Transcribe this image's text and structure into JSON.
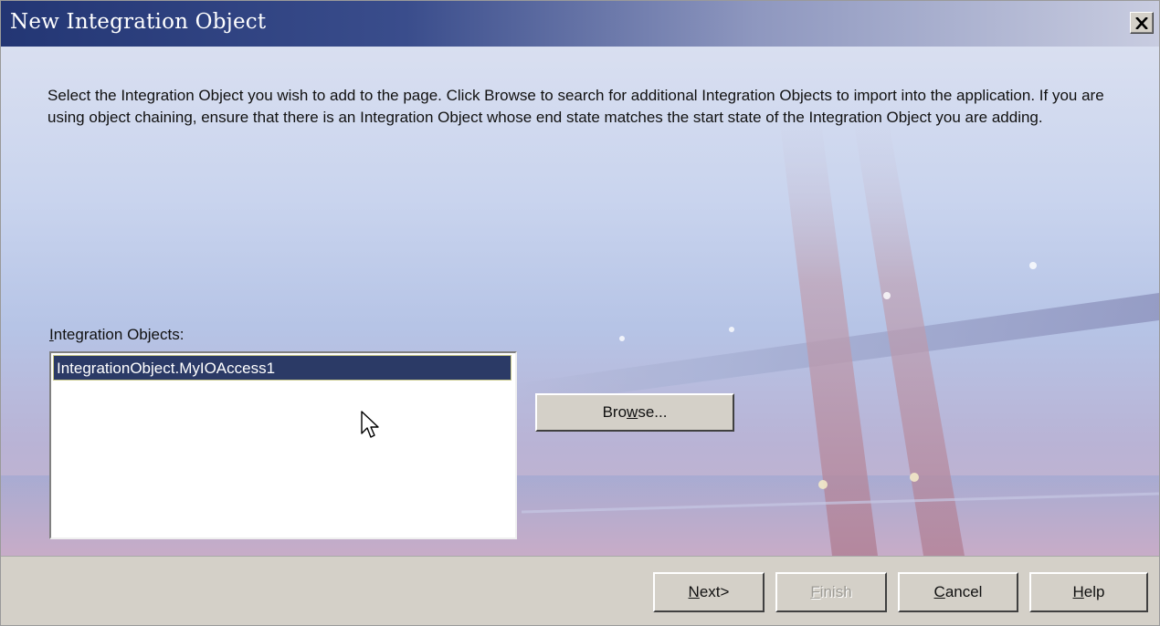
{
  "window": {
    "title": "New Integration Object"
  },
  "instructions": "Select the Integration Object you wish to add to the page. Click Browse to search for additional Integration Objects to import into the application. If you are using object chaining, ensure that there is an Integration Object whose end state matches the start state of the Integration Object you are adding.",
  "integration_objects": {
    "label_mnemonic": "I",
    "label_rest": "ntegration Objects:",
    "items": [
      {
        "label": "IntegrationObject.MyIOAccess1",
        "selected": true
      }
    ]
  },
  "browse": {
    "pre": "Bro",
    "mnemonic": "w",
    "post": "se..."
  },
  "buttons": {
    "next": {
      "mnemonic": "N",
      "rest": "ext>"
    },
    "finish": {
      "mnemonic": "F",
      "rest": "inish",
      "enabled": false
    },
    "cancel": {
      "mnemonic": "C",
      "rest": "ancel"
    },
    "help": {
      "mnemonic": "H",
      "rest": "elp"
    }
  },
  "colors": {
    "title_start": "#233674",
    "selection": "#2b3a66",
    "face": "#d4d0c8"
  },
  "icons": {
    "close": "close-icon",
    "pointer": "mouse-pointer-icon"
  }
}
